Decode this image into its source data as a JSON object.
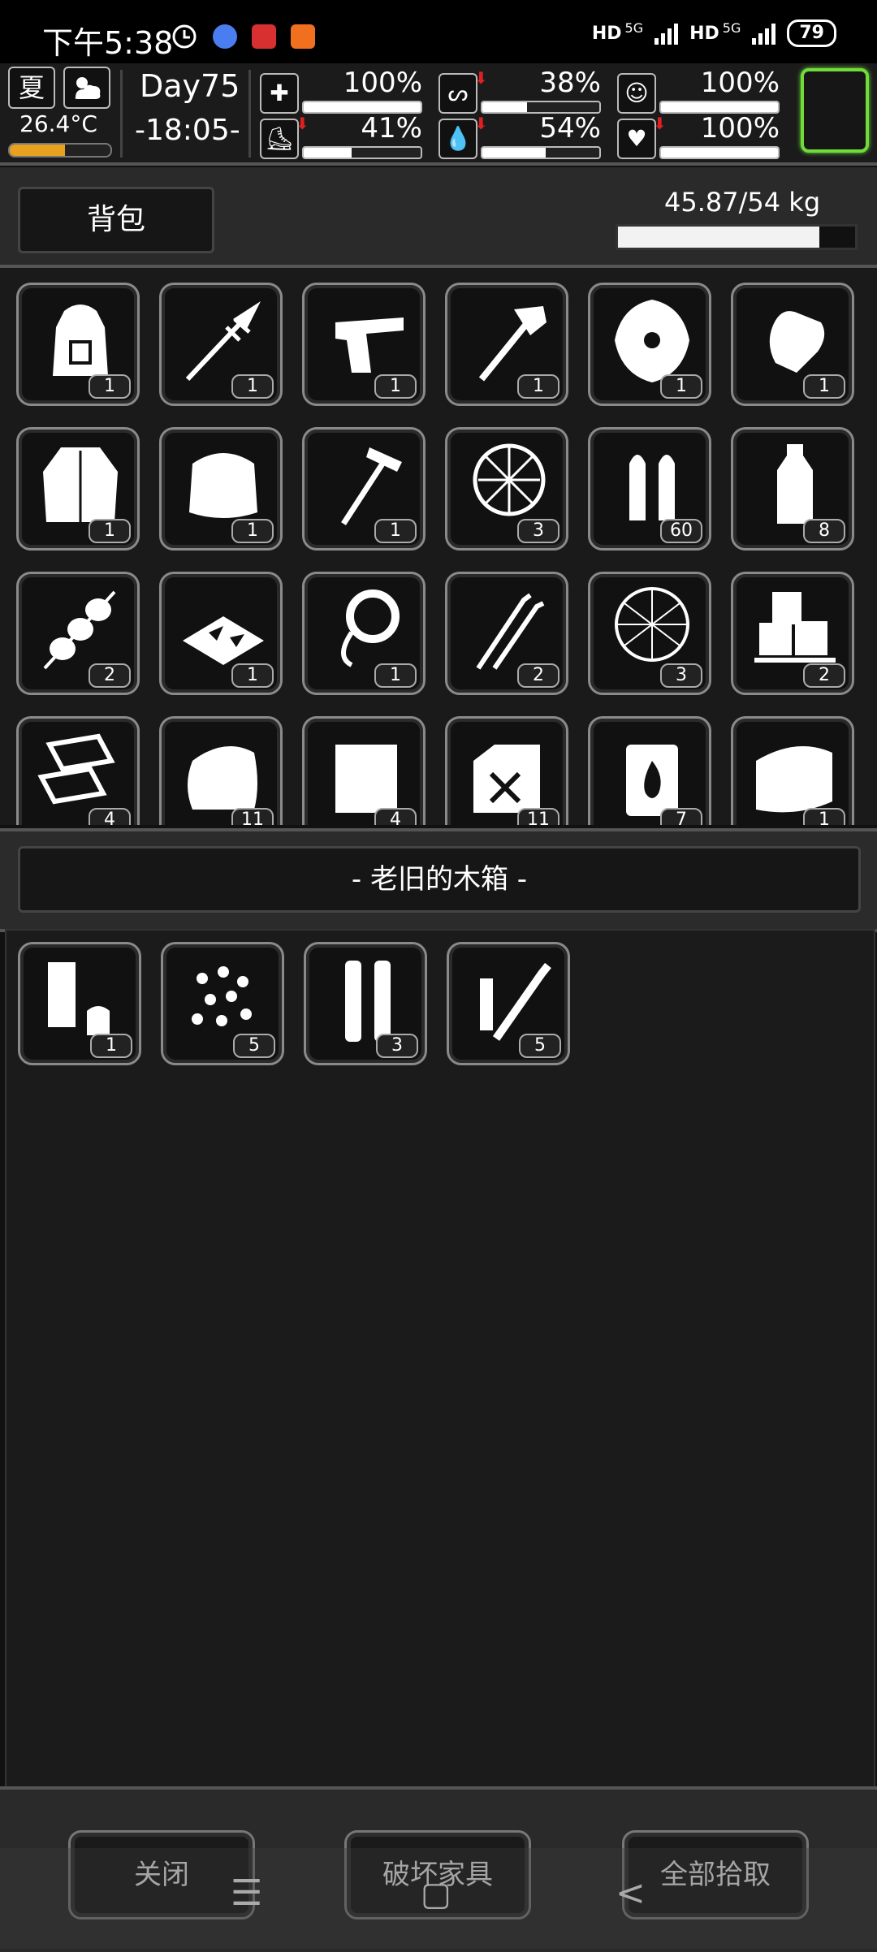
{
  "status_bar": {
    "time": "下午5:38",
    "network": [
      "HD",
      "5G",
      "HD",
      "5G"
    ],
    "battery": "79"
  },
  "hud": {
    "season": "夏",
    "temperature": "26.4°C",
    "temperature_level": 0.55,
    "day": "Day75",
    "clock": "-18:05-",
    "stats": [
      {
        "name": "health",
        "icon": "first-aid-kit",
        "value": "100%",
        "level": 1.0,
        "decreasing": false
      },
      {
        "name": "hunger",
        "icon": "stomach",
        "value": "38%",
        "level": 0.38,
        "decreasing": true
      },
      {
        "name": "mood",
        "icon": "face",
        "value": "100%",
        "level": 1.0,
        "decreasing": false
      },
      {
        "name": "stamina",
        "icon": "boot",
        "value": "41%",
        "level": 0.41,
        "decreasing": true
      },
      {
        "name": "thirst",
        "icon": "water-drop",
        "value": "54%",
        "level": 0.54,
        "decreasing": true
      },
      {
        "name": "heart",
        "icon": "heart",
        "value": "100%",
        "level": 1.0,
        "decreasing": true
      }
    ]
  },
  "backpack": {
    "title": "背包",
    "weight": "45.87/54 kg",
    "weight_level": 0.85,
    "items": [
      {
        "icon": "backpack",
        "count": "1"
      },
      {
        "icon": "spear",
        "count": "1"
      },
      {
        "icon": "pistol",
        "count": "1"
      },
      {
        "icon": "pickaxe",
        "count": "1"
      },
      {
        "icon": "shield",
        "count": "1"
      },
      {
        "icon": "gloves",
        "count": "1"
      },
      {
        "icon": "jacket",
        "count": "1"
      },
      {
        "icon": "fur-hat",
        "count": "1"
      },
      {
        "icon": "hammer",
        "count": "1"
      },
      {
        "icon": "net",
        "count": "3"
      },
      {
        "icon": "bullets",
        "count": "60"
      },
      {
        "icon": "water-bottle",
        "count": "8"
      },
      {
        "icon": "skewer",
        "count": "2"
      },
      {
        "icon": "nachos-tray",
        "count": "1"
      },
      {
        "icon": "rope",
        "count": "1"
      },
      {
        "icon": "lockpicks",
        "count": "2"
      },
      {
        "icon": "fishing-net",
        "count": "3"
      },
      {
        "icon": "ice-cubes",
        "count": "2"
      },
      {
        "icon": "cardboard",
        "count": "4"
      },
      {
        "icon": "cloth-pile",
        "count": "11"
      },
      {
        "icon": "paper",
        "count": "4"
      },
      {
        "icon": "fuel-can",
        "count": "11"
      },
      {
        "icon": "fire-barrel",
        "count": "7"
      },
      {
        "icon": "towel",
        "count": "1"
      }
    ]
  },
  "container": {
    "title": "- 老旧的木箱 -",
    "items": [
      {
        "icon": "cigarette-paper",
        "count": "1"
      },
      {
        "icon": "seeds",
        "count": "5"
      },
      {
        "icon": "batteries",
        "count": "3"
      },
      {
        "icon": "screwdriver-set",
        "count": "5"
      }
    ]
  },
  "buttons": {
    "close": "关闭",
    "destroy": "破坏家具",
    "take_all": "全部拾取"
  },
  "nav": [
    "menu-icon",
    "home-icon",
    "back-icon"
  ]
}
